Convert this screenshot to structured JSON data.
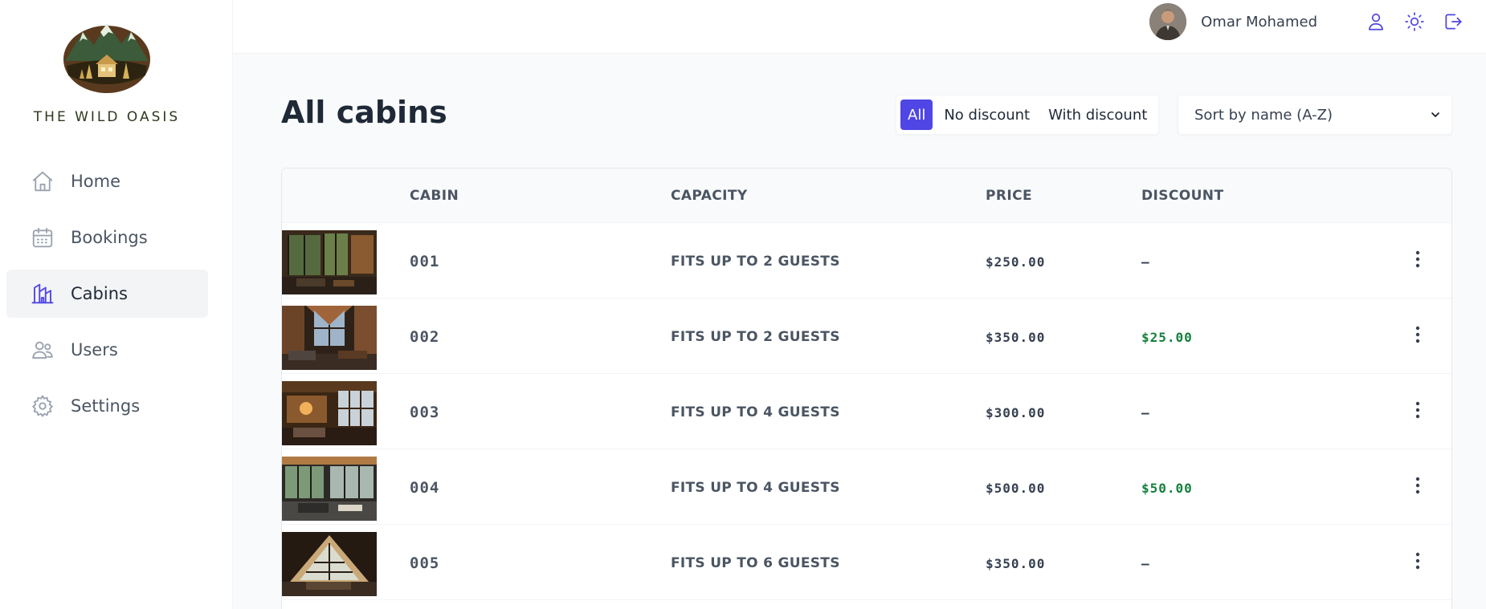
{
  "brand": {
    "name": "THE WILD OASIS"
  },
  "sidebar": {
    "items": [
      {
        "label": "Home",
        "icon": "home-icon",
        "active": false
      },
      {
        "label": "Bookings",
        "icon": "calendar-icon",
        "active": false
      },
      {
        "label": "Cabins",
        "icon": "cabin-icon",
        "active": true
      },
      {
        "label": "Users",
        "icon": "users-icon",
        "active": false
      },
      {
        "label": "Settings",
        "icon": "gear-icon",
        "active": false
      }
    ]
  },
  "header": {
    "user_name": "Omar Mohamed",
    "icons": [
      "user-icon",
      "sun-icon",
      "logout-icon"
    ]
  },
  "main": {
    "title": "All cabins",
    "filter": {
      "options": [
        "All",
        "No discount",
        "With discount"
      ],
      "active": "All"
    },
    "sort": {
      "selected": "Sort by name (A-Z)"
    },
    "table": {
      "columns": [
        "",
        "CABIN",
        "CAPACITY",
        "PRICE",
        "DISCOUNT",
        ""
      ],
      "rows": [
        {
          "name": "001",
          "capacity": "FITS UP TO 2 GUESTS",
          "price": "$250.00",
          "discount": "—"
        },
        {
          "name": "002",
          "capacity": "FITS UP TO 2 GUESTS",
          "price": "$350.00",
          "discount": "$25.00"
        },
        {
          "name": "003",
          "capacity": "FITS UP TO 4 GUESTS",
          "price": "$300.00",
          "discount": "—"
        },
        {
          "name": "004",
          "capacity": "FITS UP TO 4 GUESTS",
          "price": "$500.00",
          "discount": "$50.00"
        },
        {
          "name": "005",
          "capacity": "FITS UP TO 6 GUESTS",
          "price": "$350.00",
          "discount": "—"
        }
      ]
    }
  },
  "colors": {
    "accent": "#4f46e5",
    "discount_green": "#15803d",
    "sidebar_active_bg": "#f3f4f6"
  }
}
